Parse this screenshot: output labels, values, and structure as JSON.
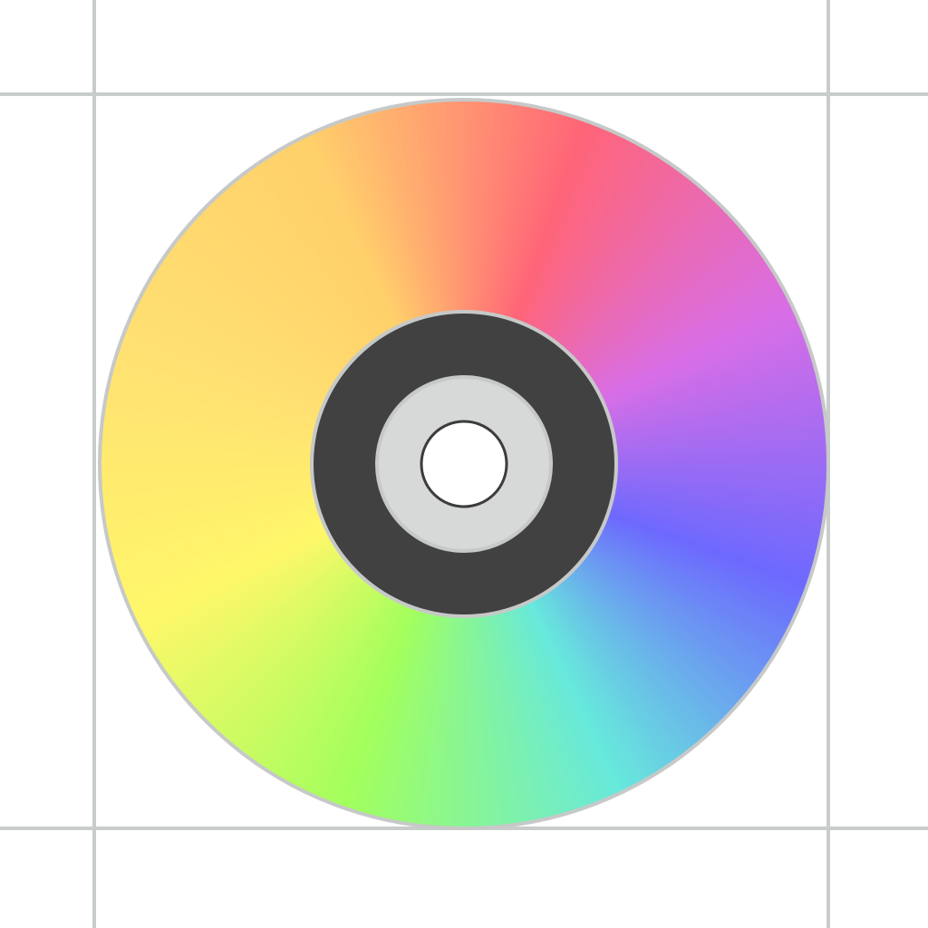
{
  "icon": {
    "name": "optical-disc-icon",
    "description_colors": {
      "guide_lines": "#c8cdcc",
      "disc_rim": "#c6c9c8",
      "hub_ring": "#414141",
      "hub_inner": "#d7d8d8",
      "hub_inner_border": "#c6c9c8",
      "spindle_hole": "#ffffff",
      "spindle_hole_border": "#3c3c3c"
    },
    "spectrum_colors": [
      "#ffe072",
      "#fff76a",
      "#a3ff5c",
      "#67e9dc",
      "#6d69fe",
      "#d86ee6",
      "#ff6578",
      "#ffd06b"
    ]
  }
}
